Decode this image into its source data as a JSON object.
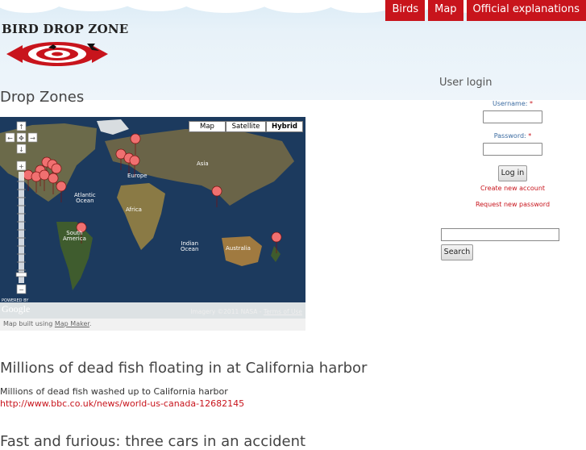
{
  "site": {
    "name": "BIRD DROP ZONE"
  },
  "nav": {
    "items": [
      "Birds",
      "Map",
      "Official explanations"
    ]
  },
  "page": {
    "title": "Drop Zones"
  },
  "map": {
    "type_buttons": [
      "Map",
      "Satellite",
      "Hybrid"
    ],
    "active_type": "Hybrid",
    "caption_prefix": "Map built using ",
    "caption_link": "Map Maker",
    "caption_suffix": ".",
    "copyright_prefix": "Imagery ©2011 NASA - ",
    "copyright_link": "Terms of Use",
    "powered_by": "POWERED BY",
    "google": "Google",
    "labels": {
      "asia": "Asia",
      "europe": "Europe",
      "africa": "Africa",
      "atlantic": "Atlantic\nOcean",
      "indian": "Indian\nOcean",
      "australia": "Australia",
      "south_america": "South\nAmerica"
    }
  },
  "login": {
    "title": "User login",
    "username_label": "Username:",
    "password_label": "Password:",
    "required_mark": "*",
    "login_button": "Log in",
    "create_account": "Create new account",
    "request_password": "Request new password"
  },
  "search": {
    "button": "Search"
  },
  "articles": [
    {
      "title": "Millions of dead fish floating in at California harbor",
      "body": "Millions of dead fish washed up to California harbor",
      "link": "http://www.bbc.co.uk/news/world-us-canada-12682145"
    },
    {
      "title": "Fast and furious: three cars in an accident"
    }
  ],
  "colors": {
    "accent": "#c8141c",
    "map_ocean": "#1c3a5e",
    "marker": "#f07070"
  }
}
